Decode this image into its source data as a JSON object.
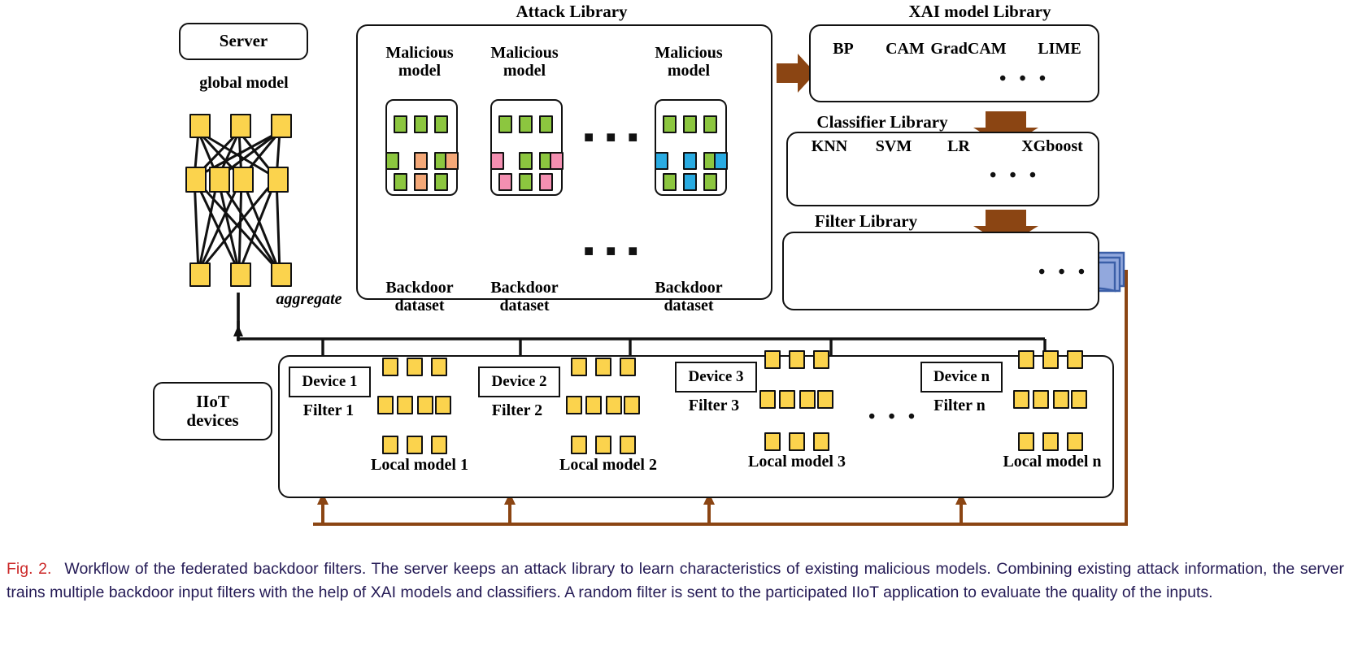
{
  "figure": {
    "number": "Fig. 2.",
    "caption": "Workflow of the federated backdoor filters. The server keeps an attack library to learn characteristics of existing malicious models. Combining existing attack information, the server trains multiple backdoor input filters with the help of XAI models and classifiers. A random filter is sent to the participated IIoT application to evaluate the quality of the inputs."
  },
  "server": {
    "box_label": "Server",
    "model_label": "global model",
    "aggregate_label": "aggregate"
  },
  "attack_library": {
    "title": "Attack Library",
    "models": [
      {
        "label": "Malicious\nmodel",
        "dataset_label": "Backdoor\ndataset",
        "node_color": "#F4A878",
        "dataset_color": "#FBE9A6",
        "arrow_color": "#FBE9A6"
      },
      {
        "label": "Malicious\nmodel",
        "dataset_label": "Backdoor\ndataset",
        "node_color": "#F4B8A0",
        "dataset_color": "#EEC2AC",
        "arrow_color": "#EEC2AC"
      },
      {
        "label": "Malicious\nmodel",
        "dataset_label": "Backdoor\ndataset",
        "node_color": "#29ABE2",
        "dataset_color": "#B8C4D9",
        "arrow_color": "#B8C4D9"
      }
    ],
    "model2_node_color": "#F48FB1",
    "base_node_color": "#8CC63F",
    "ellipsis": "■ ■ ■"
  },
  "xai_library": {
    "title": "XAI model Library",
    "items": [
      {
        "label": "BP",
        "color": "#F4A878"
      },
      {
        "label": "CAM",
        "color": "#6E6E6E"
      },
      {
        "label": "GradCAM",
        "color": "#FCD34D"
      },
      {
        "label": "LIME",
        "color": "#93C2E6"
      }
    ],
    "ellipsis": "• • •"
  },
  "classifier_library": {
    "title": "Classifier Library",
    "items": [
      {
        "label": "KNN",
        "color": "#F0A783"
      },
      {
        "label": "SVM",
        "color": "#6E6E6E"
      },
      {
        "label": "LR",
        "color": "#FCD34D"
      },
      {
        "label": "XGboost",
        "color": "#9FC5E8"
      }
    ],
    "ellipsis": "• • •"
  },
  "filter_library": {
    "title": "Filter Library",
    "items": [
      {
        "color": "#F7931E"
      },
      {
        "color": "#FBD97A"
      },
      {
        "color": "#7DC242"
      },
      {
        "color": "#92A8DD"
      }
    ],
    "ellipsis": "• • •"
  },
  "iiot": {
    "box_label": "IIoT\ndevices",
    "devices": [
      {
        "name": "Device 1",
        "filter_label": "Filter 1",
        "model_label": "Local model 1",
        "filter_color": "#F2A07B"
      },
      {
        "name": "Device 2",
        "filter_label": "Filter 2",
        "model_label": "Local model 2",
        "filter_color": "#BEE0B0"
      },
      {
        "name": "Device 3",
        "filter_label": "Filter 3",
        "model_label": "Local model 3",
        "filter_color": "#8FB4E3"
      },
      {
        "name": "Device n",
        "filter_label": "Filter n",
        "model_label": "Local model n",
        "filter_color": "#808080"
      }
    ],
    "ellipsis": "• • •",
    "node_color": "#FBD34D"
  },
  "colors": {
    "brown_arrow": "#8B4513",
    "node_yellow": "#FBD34D",
    "stroke": "#111111"
  }
}
